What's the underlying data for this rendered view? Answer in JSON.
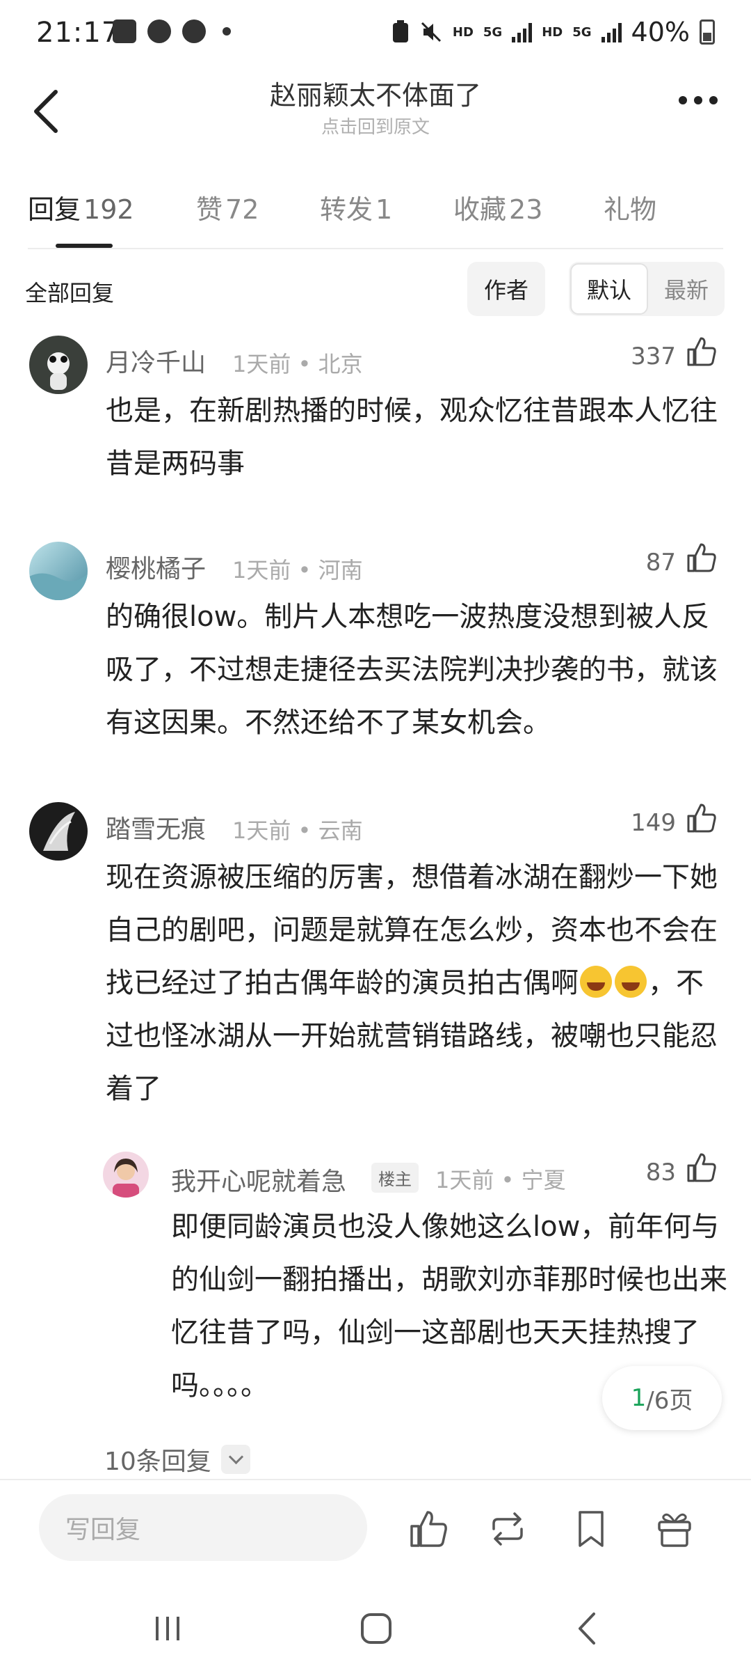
{
  "status": {
    "time": "21:17",
    "battery": "40%",
    "net1": "HD",
    "net2": "5G",
    "net3": "HD",
    "net4": "5G"
  },
  "header": {
    "title": "赵丽颖太不体面了",
    "subtitle": "点击回到原文"
  },
  "tabs": [
    {
      "label": "回复",
      "count": "192"
    },
    {
      "label": "赞",
      "count": "72"
    },
    {
      "label": "转发",
      "count": "1"
    },
    {
      "label": "收藏",
      "count": "23"
    },
    {
      "label": "礼物",
      "count": ""
    }
  ],
  "filter": {
    "title": "全部回复",
    "author": "作者",
    "sort_default": "默认",
    "sort_latest": "最新"
  },
  "comments": [
    {
      "name": "月冷千山",
      "meta": "1天前 • 北京",
      "likes": "337",
      "body": "也是，在新剧热播的时候，观众忆往昔跟本人忆往昔是两码事"
    },
    {
      "name": "樱桃橘子",
      "meta": "1天前 • 河南",
      "likes": "87",
      "body": "的确很low。制片人本想吃一波热度没想到被人反吸了，不过想走捷径去买法院判决抄袭的书，就该有这因果。不然还给不了某女机会。"
    },
    {
      "name": "踏雪无痕",
      "meta": "1天前 • 云南",
      "likes": "149",
      "body_a": "现在资源被压缩的厉害，想借着冰湖在翻炒一下她自己的剧吧，问题是就算在怎么炒，资本也不会在找已经过了拍古偶年龄的演员拍古偶啊",
      "body_b": "，不过也怪冰湖从一开始就营销错路线，被嘲也只能忍着了"
    }
  ],
  "reply": {
    "name": "我开心呢就着急",
    "badge": "楼主",
    "meta": "1天前 • 宁夏",
    "likes": "83",
    "body": "即便同龄演员也没人像她这么low，前年何与的仙剑一翻拍播出，胡歌刘亦菲那时候也出来忆往昔了吗，仙剑一这部剧也天天挂热搜了吗。。。。"
  },
  "pager": {
    "current": "1",
    "rest": "/6页"
  },
  "more_replies": "10条回复",
  "bottom": {
    "input_placeholder": "写回复"
  },
  "colors": {
    "accent_green": "#1aa35a",
    "text_main": "#222222",
    "text_meta": "#aaaaaa"
  }
}
